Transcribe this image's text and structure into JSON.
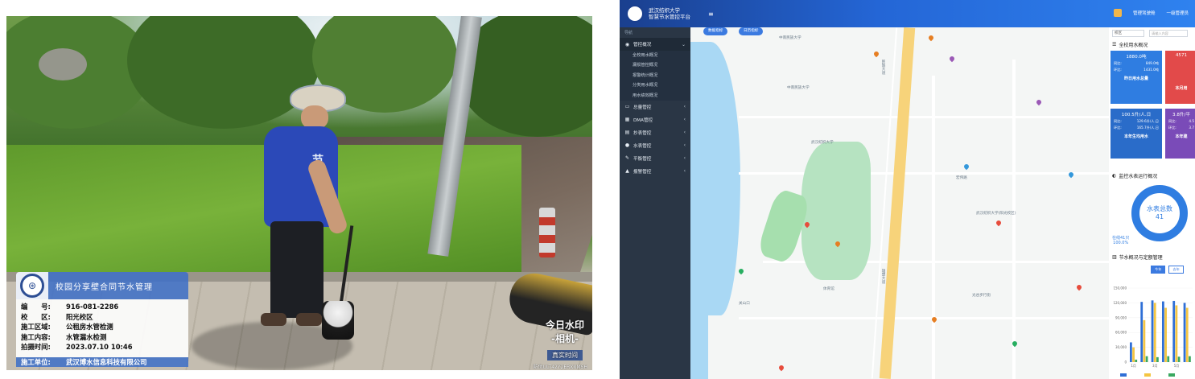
{
  "photo": {
    "vest_text": "节水",
    "watermark": {
      "title": "校园分享壁合同节水管理",
      "rows": [
        {
          "k": "编　　号:",
          "v": "916-081-2286"
        },
        {
          "k": "校　　区:",
          "v": "阳光校区"
        },
        {
          "k": "施工区域:",
          "v": "公租房水管检测"
        },
        {
          "k": "施工内容:",
          "v": "水管漏水检测"
        },
        {
          "k": "拍摄时间:",
          "v": "2023.07.10 10:46"
        }
      ],
      "footer": {
        "k": "施工单位:",
        "v": "武汉博水信息科技有限公司"
      }
    },
    "brand": {
      "line1": "今日水印",
      "line2": "-相机-",
      "line3": "真实时间"
    },
    "code": "防伪ULT42Y2ERXXMSH"
  },
  "dashboard": {
    "header": {
      "title_line1": "武汉纺织大学",
      "title_line2": "智慧节水管控平台",
      "menu_icon": "hamburger-icon",
      "notice": "管理驾驶舱",
      "user": "一级管理员"
    },
    "sidebar": {
      "section": "导航",
      "items": [
        {
          "label": "管控概况",
          "icon": "dashboard-icon",
          "expanded": true
        },
        {
          "label": "总量管控",
          "icon": "monitor-icon"
        },
        {
          "label": "DMA管控",
          "icon": "grid-icon"
        },
        {
          "label": "抄表管控",
          "icon": "calendar-icon"
        },
        {
          "label": "水表管控",
          "icon": "gauge-icon"
        },
        {
          "label": "平衡管控",
          "icon": "edit-icon"
        },
        {
          "label": "报警管控",
          "icon": "warning-icon"
        }
      ],
      "subitems": [
        "全校用水概况",
        "漏损管控概况",
        "报警统计概况",
        "分类用水概况",
        "用水绩效概况"
      ]
    },
    "map": {
      "chips": [
        "数据指标",
        "日历指标"
      ],
      "labels": [
        "中南民族大学",
        "武汉纺织大学",
        "民族大道",
        "中南民族大学",
        "雄楚大道",
        "武汉纺织大学(阳光校区)",
        "体育馆",
        "宏伟路",
        "光谷步行街",
        "关山口"
      ]
    },
    "panel": {
      "filter_select": "校区",
      "filter_input": "请输入内容",
      "title": "全校用水概况",
      "cards": [
        {
          "big": "1880.0吨",
          "r1k": "同比:",
          "r1v": "849.0吨",
          "r2k": "环比:",
          "r2v": "1431.0吨",
          "foot": "昨日用水总量",
          "color": "#2f7de1"
        },
        {
          "big": "4571",
          "r1k": "",
          "r1v": "",
          "r2k": "",
          "r2v": "",
          "foot": "本月用",
          "color": "#e24a4a"
        },
        {
          "big": "100.5升/人.日",
          "r1k": "同比:",
          "r1v": "129.6升/人.日",
          "r2k": "环比:",
          "r2v": "165.7升/人.日",
          "foot": "本年生均用水",
          "color": "#2a6cc9"
        },
        {
          "big": "3.8升/平",
          "r1k": "同比:",
          "r1v": "4.5",
          "r2k": "环比:",
          "r2v": "3.7",
          "foot": "本年建",
          "color": "#7a4bb8"
        }
      ],
      "meter_title": "监控水表运行概况",
      "donut_label": "水表总数",
      "donut_value": "41",
      "online_label": "在线41只",
      "online_pct": "100.0%",
      "save_title": "节水概况与定额管理",
      "tabs": [
        "今年",
        "去年"
      ],
      "chart_ticks": [
        "150,000",
        "120,000",
        "90,000",
        "60,000",
        "30,000",
        "0"
      ],
      "chart_months": [
        "1月",
        "3月",
        "5月"
      ]
    }
  },
  "chart_data": {
    "type": "bar",
    "categories": [
      "1月",
      "2月",
      "3月",
      "4月",
      "5月",
      "6月"
    ],
    "series": [
      {
        "values": [
          40000,
          122000,
          125000,
          123000,
          124000,
          120000
        ]
      },
      {
        "values": [
          30000,
          85000,
          120000,
          110000,
          115000,
          110000
        ]
      },
      {
        "values": [
          5000,
          12000,
          10000,
          12000,
          11000,
          12000
        ]
      }
    ],
    "ylim": [
      0,
      150000
    ],
    "colors": [
      "#2f6fd6",
      "#f4c542",
      "#3aa860"
    ]
  }
}
